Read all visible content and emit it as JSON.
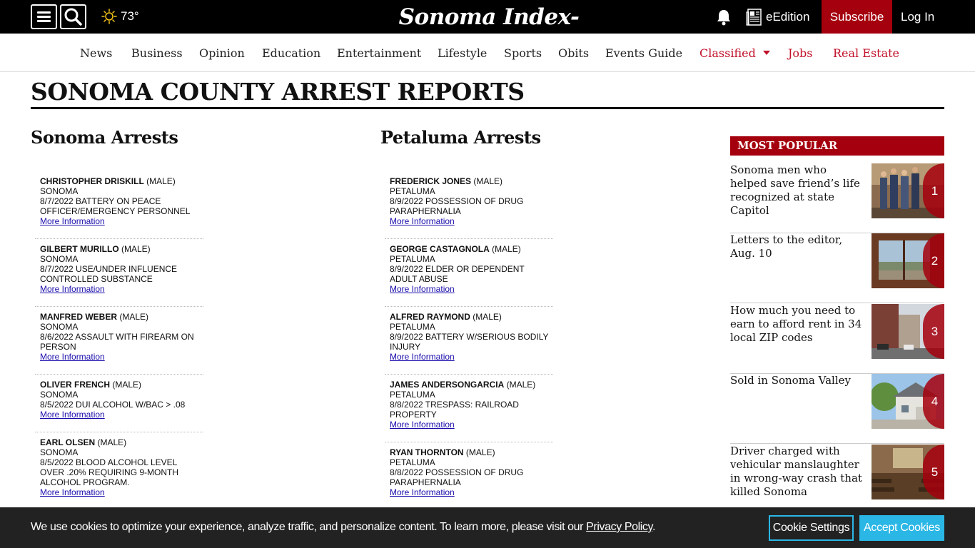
{
  "header": {
    "weather_temp": "73°",
    "logo": "Sonoma Index-Tribune",
    "eedition": "eEdition",
    "subscribe": "Subscribe",
    "login": "Log In"
  },
  "nav": {
    "items": [
      "News",
      "Business",
      "Opinion",
      "Education",
      "Entertainment",
      "Lifestyle",
      "Sports",
      "Obits",
      "Events Guide",
      "Classified",
      "Jobs",
      "Real Estate"
    ]
  },
  "page_title": "SONOMA COUNTY ARREST REPORTS",
  "sonoma": {
    "title": "Sonoma Arrests",
    "arrests": [
      {
        "name": "CHRISTOPHER DRISKILL",
        "sex": " (MALE)",
        "city": "SONOMA",
        "charge": "8/7/2022 BATTERY ON PEACE OFFICER/EMERGENCY PERSONNEL",
        "more": "More Information"
      },
      {
        "name": "GILBERT MURILLO",
        "sex": " (MALE)",
        "city": "SONOMA",
        "charge": "8/7/2022 USE/UNDER INFLUENCE CONTROLLED SUBSTANCE",
        "more": "More Information"
      },
      {
        "name": "MANFRED WEBER",
        "sex": " (MALE)",
        "city": "SONOMA",
        "charge": "8/6/2022 ASSAULT WITH FIREARM ON PERSON",
        "more": "More Information"
      },
      {
        "name": "OLIVER FRENCH",
        "sex": " (MALE)",
        "city": "SONOMA",
        "charge": "8/5/2022 DUI ALCOHOL W/BAC > .08",
        "more": "More Information"
      },
      {
        "name": "EARL OLSEN",
        "sex": " (MALE)",
        "city": "SONOMA",
        "charge": "8/5/2022 BLOOD ALCOHOL LEVEL OVER .20% REQUIRING 9-MONTH ALCOHOL PROGRAM.",
        "more": "More Information"
      }
    ]
  },
  "petaluma": {
    "title": "Petaluma Arrests",
    "arrests": [
      {
        "name": "FREDERICK JONES",
        "sex": " (MALE)",
        "city": "PETALUMA",
        "charge": "8/9/2022 POSSESSION OF DRUG PARAPHERNALIA",
        "more": "More Information"
      },
      {
        "name": "GEORGE CASTAGNOLA",
        "sex": " (MALE)",
        "city": "PETALUMA",
        "charge": "8/9/2022 ELDER OR DEPENDENT ADULT ABUSE",
        "more": "More Information"
      },
      {
        "name": "ALFRED RAYMOND",
        "sex": " (MALE)",
        "city": "PETALUMA",
        "charge": "8/9/2022 BATTERY W/SERIOUS BODILY INJURY",
        "more": "More Information"
      },
      {
        "name": "JAMES ANDERSONGARCIA",
        "sex": " (MALE)",
        "city": "PETALUMA",
        "charge": "8/8/2022 TRESPASS: RAILROAD PROPERTY",
        "more": "More Information"
      },
      {
        "name": "RYAN THORNTON",
        "sex": " (MALE)",
        "city": "PETALUMA",
        "charge": "8/8/2022 POSSESSION OF DRUG PARAPHERNALIA",
        "more": "More Information"
      }
    ]
  },
  "most_popular": {
    "title": "MOST POPULAR",
    "items": [
      {
        "rank": "1",
        "title": "Sonoma men who helped save friend’s life recognized at state Capitol"
      },
      {
        "rank": "2",
        "title": "Letters to the editor, Aug. 10"
      },
      {
        "rank": "3",
        "title": "How much you need to earn to afford rent in 34 local ZIP codes"
      },
      {
        "rank": "4",
        "title": "Sold in Sonoma Valley"
      },
      {
        "rank": "5",
        "title": "Driver charged with vehicular manslaughter in wrong-way crash that killed Sonoma"
      }
    ]
  },
  "cookie": {
    "text": "We use cookies to optimize your experience, analyze traffic, and personalize content. To learn more, please visit our ",
    "link": "Privacy Policy",
    "period": ".",
    "settings": "Cookie Settings",
    "accept": "Accept Cookies"
  },
  "colors": {
    "brand_red": "#a5000d",
    "nav_red": "#c1122a",
    "cookie_blue": "#2bb7e6"
  }
}
